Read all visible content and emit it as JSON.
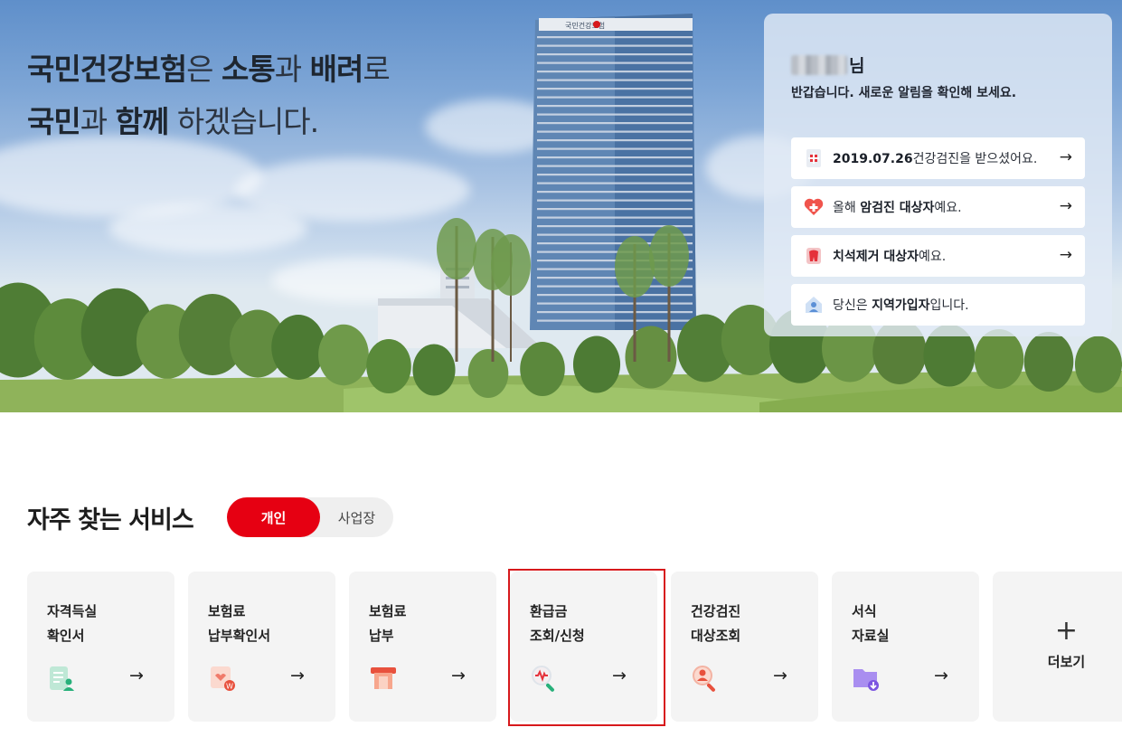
{
  "hero": {
    "line1": [
      {
        "text": "국민건강보험",
        "bold": true
      },
      {
        "text": "은 ",
        "bold": false
      },
      {
        "text": "소통",
        "bold": true
      },
      {
        "text": "과 ",
        "bold": false
      },
      {
        "text": "배려",
        "bold": true
      },
      {
        "text": "로",
        "bold": false
      }
    ],
    "line2": [
      {
        "text": "국민",
        "bold": true
      },
      {
        "text": "과 ",
        "bold": false
      },
      {
        "text": "함께",
        "bold": true
      },
      {
        "text": " 하겠습니다.",
        "bold": false
      }
    ],
    "building_sign": "국민건강보험"
  },
  "panel": {
    "user_suffix": "님",
    "greeting": "반갑습니다. 새로운 알림을 확인해 보세요.",
    "notices": [
      {
        "icon": "checkup-document-icon",
        "parts": [
          {
            "text": "2019.07.26",
            "bold": true
          },
          {
            "text": "건강검진을 받으셨어요.",
            "bold": false
          }
        ],
        "arrow": "→"
      },
      {
        "icon": "heart-cross-icon",
        "parts": [
          {
            "text": "올해 ",
            "bold": false
          },
          {
            "text": "암검진 대상자",
            "bold": true
          },
          {
            "text": "예요.",
            "bold": false
          }
        ],
        "arrow": "→"
      },
      {
        "icon": "tooth-icon",
        "parts": [
          {
            "text": "치석제거 대상자",
            "bold": true
          },
          {
            "text": "예요.",
            "bold": false
          }
        ],
        "arrow": "→"
      },
      {
        "icon": "home-person-icon",
        "parts": [
          {
            "text": "당신은 ",
            "bold": false
          },
          {
            "text": "지역가입자",
            "bold": true
          },
          {
            "text": "입니다.",
            "bold": false
          }
        ],
        "arrow": ""
      }
    ]
  },
  "services": {
    "title": "자주 찾는 서비스",
    "toggle": {
      "active": "개인",
      "inactive": "사업장"
    },
    "cards": [
      {
        "label": "자격득실\n확인서",
        "icon": "certificate-person-icon",
        "arrow": "→"
      },
      {
        "label": "보험료\n납부확인서",
        "icon": "payment-receipt-icon",
        "arrow": "→"
      },
      {
        "label": "보험료\n납부",
        "icon": "card-payment-icon",
        "arrow": "→"
      },
      {
        "label": "환급금\n조회/신청",
        "icon": "refund-search-icon",
        "arrow": "→"
      },
      {
        "label": "건강검진\n대상조회",
        "icon": "person-search-icon",
        "arrow": "→"
      },
      {
        "label": "서식\n자료실",
        "icon": "folder-download-icon",
        "arrow": "→"
      }
    ],
    "more": {
      "plus": "+",
      "label": "더보기"
    }
  }
}
